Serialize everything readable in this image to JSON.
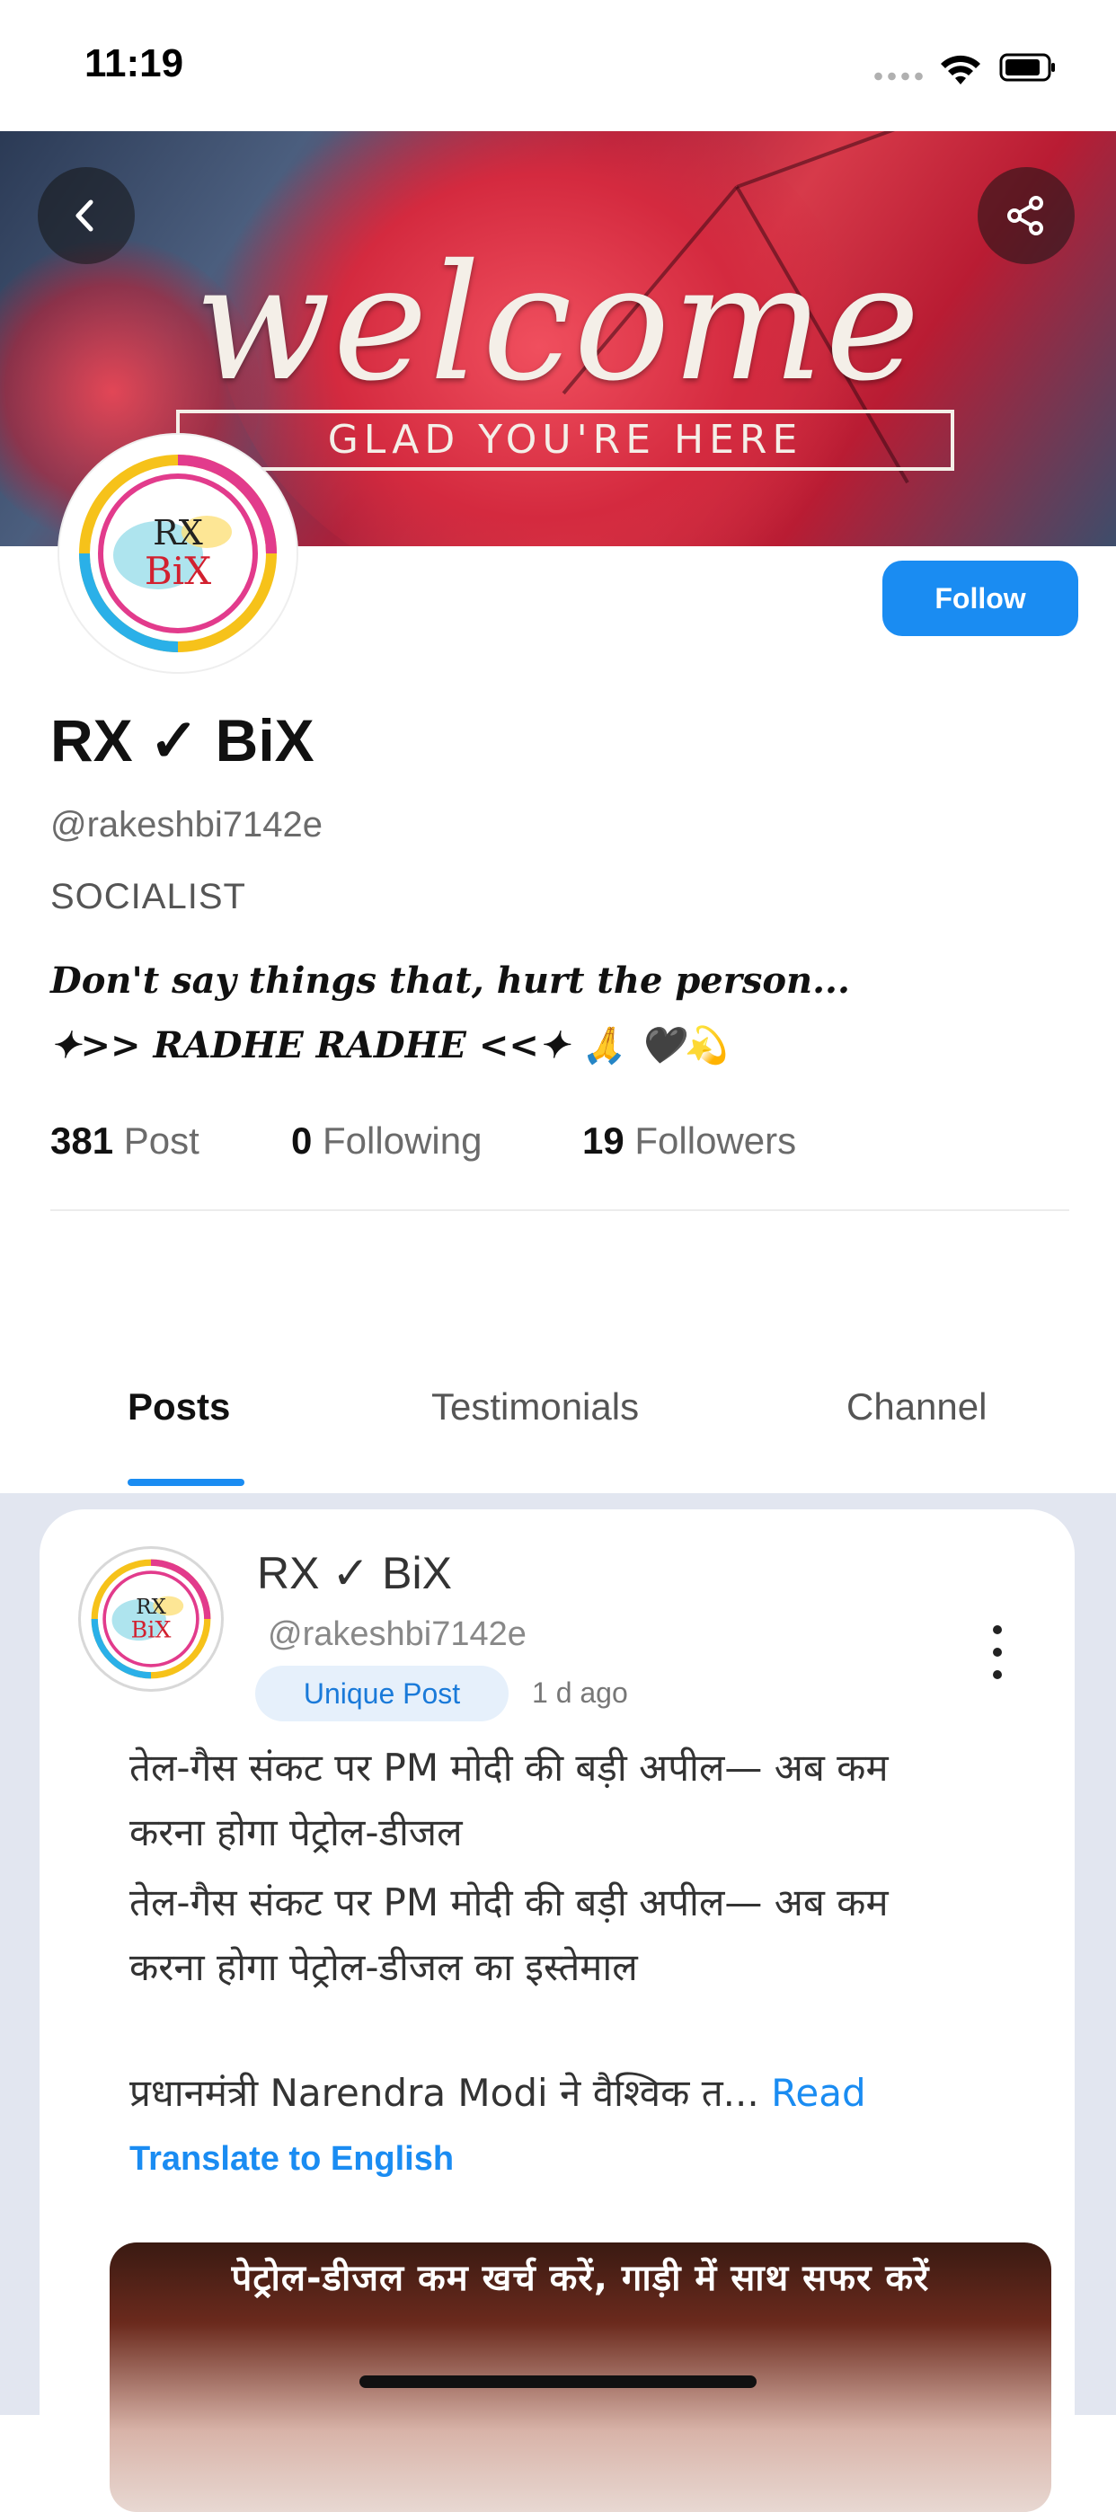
{
  "status_bar": {
    "time": "11:19"
  },
  "banner": {
    "welcome": "welcome",
    "tagline": "GLAD YOU'RE HERE"
  },
  "profile": {
    "name": "RX ✓ BiX",
    "handle": "@rakeshbi7142e",
    "role": "SOCIALIST",
    "bio_line1": "Don't say things that, hurt the person...",
    "bio_line2": "✦>> RADHE RADHE <<✦ 🙏 🖤💫",
    "follow_label": "Follow",
    "avatar_logo": {
      "line1": "RX",
      "line2": "BiX"
    }
  },
  "stats": [
    {
      "count": "381",
      "label": "Post"
    },
    {
      "count": "0",
      "label": "Following"
    },
    {
      "count": "19",
      "label": "Followers"
    }
  ],
  "tabs": [
    {
      "label": "Posts",
      "active": true
    },
    {
      "label": "Testimonials",
      "active": false
    },
    {
      "label": "Channel",
      "active": false
    }
  ],
  "post": {
    "author": "RX ✓ BiX",
    "handle": "@rakeshbi7142e",
    "badge": "Unique Post",
    "time": "1 d ago",
    "lines": [
      "तेल-गैस संकट पर PM मोदी की बड़ी अपील— अब कम",
      "करना होगा पेट्रोल-डीजल",
      "तेल-गैस संकट पर PM मोदी की बड़ी अपील— अब कम",
      "करना होगा पेट्रोल-डीजल का इस्तेमाल",
      "प्रधानमंत्री Narendra Modi ने वैश्विक त..."
    ],
    "read_more": "Read",
    "translate": "Translate to English",
    "image_caption": "पेट्रोल-डीजल कम खर्च करें, गाड़ी में साथ सफर करें"
  },
  "colors": {
    "accent": "#1a8cf2",
    "feed_bg": "#e2e6f0"
  }
}
